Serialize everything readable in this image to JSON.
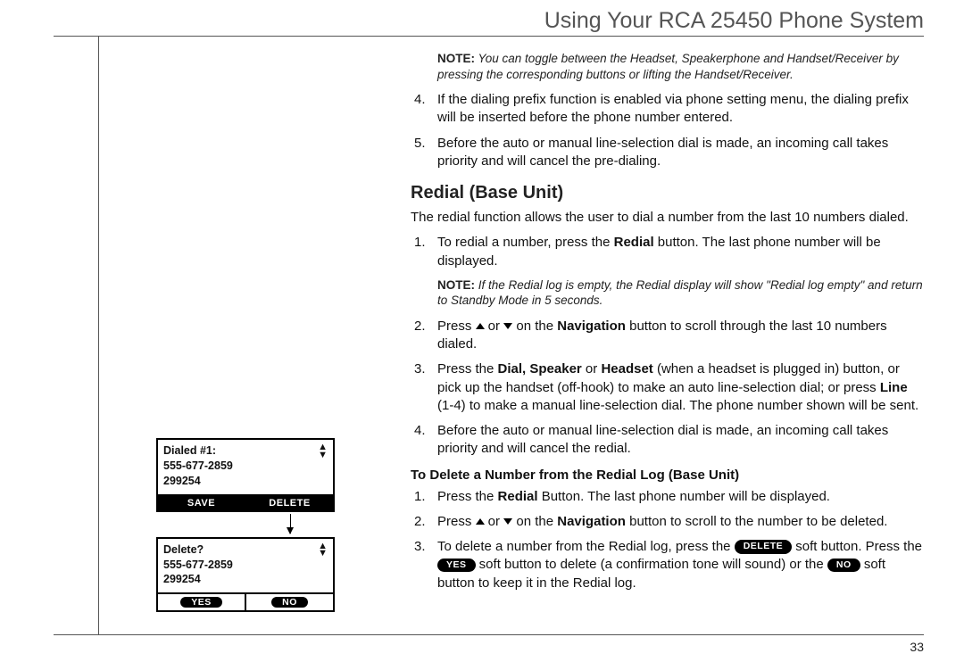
{
  "header": {
    "title": "Using Your RCA 25450 Phone System"
  },
  "note_top": {
    "label": "NOTE:",
    "text": "You can toggle between the Headset, Speakerphone and Handset/Receiver by pressing the corresponding buttons or lifting the Handset/Receiver."
  },
  "top_steps": {
    "s4_n": "4.",
    "s4": "If the dialing prefix function is enabled via phone setting menu, the dialing prefix will be inserted before the phone number entered.",
    "s5_n": "5.",
    "s5": "Before the auto or manual line-selection dial is made, an incoming call takes priority and will cancel the pre-dialing."
  },
  "redial": {
    "heading": "Redial (Base Unit)",
    "intro": "The redial function allows the user to dial a number from the last 10 numbers dialed.",
    "s1_n": "1.",
    "s1_a": "To redial a number, press the ",
    "s1_bold": "Redial",
    "s1_b": " button. The last phone number will be displayed.",
    "note": {
      "label": "NOTE:",
      "text": "If the Redial log is empty, the Redial display will show \"Redial log empty\" and return to Standby Mode in 5 seconds."
    },
    "s2_n": "2.",
    "s2_a": "Press ",
    "s2_mid": " or ",
    "s2_b": " on the ",
    "s2_bold": "Navigation",
    "s2_c": " button to scroll through the last 10 numbers dialed.",
    "s3_n": "3.",
    "s3_a": "Press the ",
    "s3_bold1": "Dial, Speaker",
    "s3_mid1": " or ",
    "s3_bold2": "Headset",
    "s3_b": " (when a headset is plugged in) button, or pick up the handset (off-hook) to make an auto line-selection dial; or press ",
    "s3_bold3": "Line",
    "s3_c": " (1-4) to make a manual line-selection dial. The phone number shown will be sent.",
    "s4_n": "4.",
    "s4": "Before the auto or manual line-selection dial is made, an incoming call takes priority and will cancel the redial."
  },
  "delete_section": {
    "heading": "To Delete a Number from the Redial Log (Base Unit)",
    "s1_n": "1.",
    "s1_a": "Press the ",
    "s1_bold": "Redial",
    "s1_b": " Button. The last phone number will be displayed.",
    "s2_n": "2.",
    "s2_a": "Press ",
    "s2_mid": " or ",
    "s2_b": " on the ",
    "s2_bold": "Navigation",
    "s2_c": " button to scroll to the number to be deleted.",
    "s3_n": "3.",
    "s3_a": "To delete a number from the Redial log, press the ",
    "s3_pill1": "DELETE",
    "s3_b": " soft button. Press the ",
    "s3_pill2": "YES",
    "s3_c": " soft button to delete (a confirmation tone will sound) or the ",
    "s3_pill3": "NO",
    "s3_d": " soft button to keep it in the Redial log."
  },
  "lcd1": {
    "line1": "Dialed #1:",
    "line2": "555-677-2859",
    "line3": "299254",
    "softL": "SAVE",
    "softR": "DELETE"
  },
  "lcd2": {
    "line1": "Delete?",
    "line2": "555-677-2859",
    "line3": "299254",
    "softL": "YES",
    "softR": "NO"
  },
  "page_number": "33"
}
